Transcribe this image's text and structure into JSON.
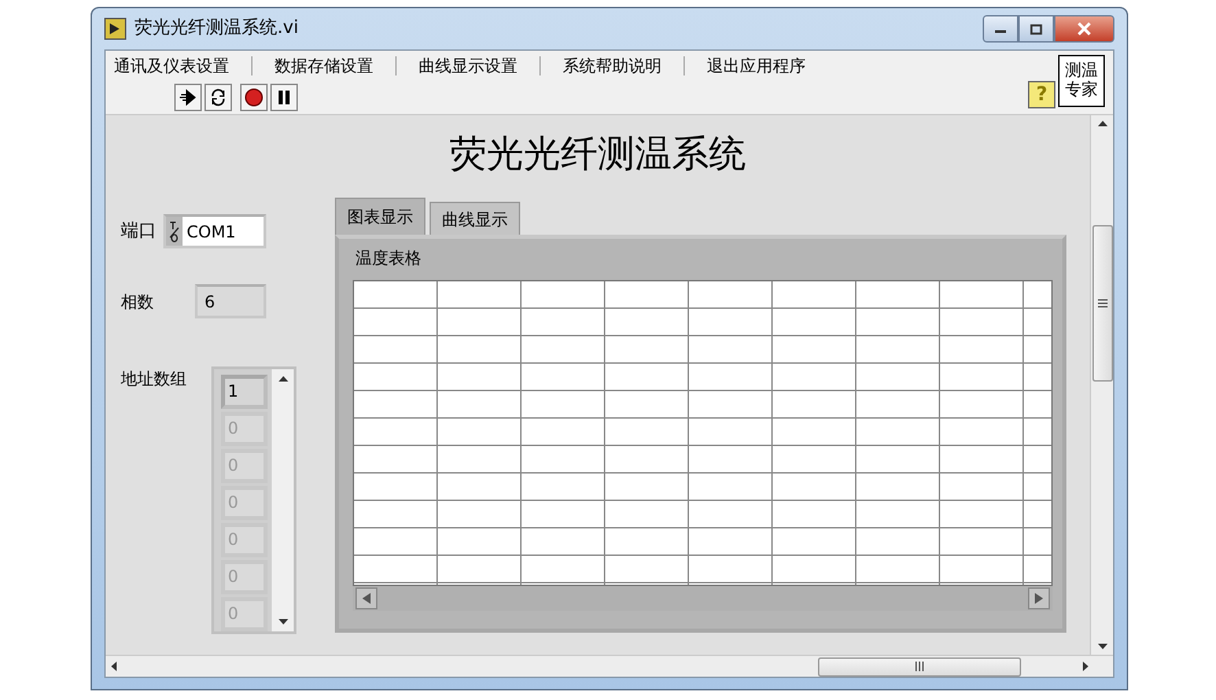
{
  "window": {
    "title": "荧光光纤测温系统.vi"
  },
  "menu": [
    {
      "label": "通讯及仪表设置"
    },
    {
      "label": "数据存储设置"
    },
    {
      "label": "曲线显示设置"
    },
    {
      "label": "系统帮助说明"
    },
    {
      "label": "退出应用程序"
    }
  ],
  "corner_label": "测温专家",
  "toolbar": {
    "buttons": [
      {
        "kind": "run"
      },
      {
        "kind": "run-continuous"
      },
      {
        "kind": "abort"
      },
      {
        "kind": "pause"
      }
    ],
    "help": "?"
  },
  "panel": {
    "heading": "荧光光纤测温系统",
    "port": {
      "label": "端口",
      "value": "COM1"
    },
    "phases": {
      "label": "相数",
      "value": "6"
    },
    "address_array": {
      "label": "地址数组",
      "items": [
        {
          "value": "1",
          "disabled": false
        },
        {
          "value": "0",
          "disabled": true
        },
        {
          "value": "0",
          "disabled": true
        },
        {
          "value": "0",
          "disabled": true
        },
        {
          "value": "0",
          "disabled": true
        },
        {
          "value": "0",
          "disabled": true
        },
        {
          "value": "0",
          "disabled": true
        }
      ]
    },
    "tabs": [
      {
        "label": "图表显示",
        "selected": true
      },
      {
        "label": "曲线显示",
        "selected": false
      }
    ],
    "table": {
      "label": "温度表格"
    }
  }
}
